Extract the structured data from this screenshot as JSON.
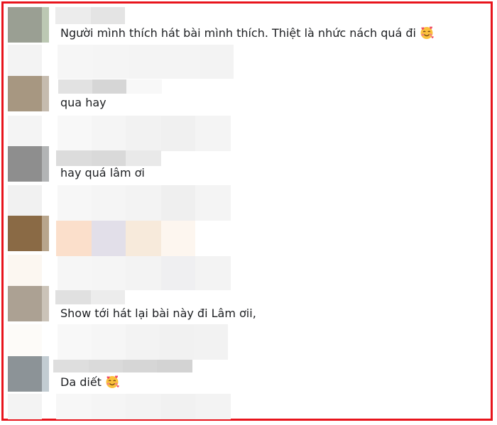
{
  "border_color": "#e8141c",
  "text_color": "#1c1e21",
  "comments": [
    {
      "text": "Người mình thích hát bài mình thích. Thiệt là nhức nách quá đi",
      "emoji": "smiling-face-with-hearts-icon"
    },
    {
      "text": "qua hay",
      "emoji": null
    },
    {
      "text": "hay quá lâm ơi",
      "emoji": null
    },
    {
      "text": "Show tới hát lại bài này đi Lâm ơii,",
      "emoji": null
    },
    {
      "text": "Da diết",
      "emoji": "smiling-face-with-hearts-icon"
    }
  ]
}
